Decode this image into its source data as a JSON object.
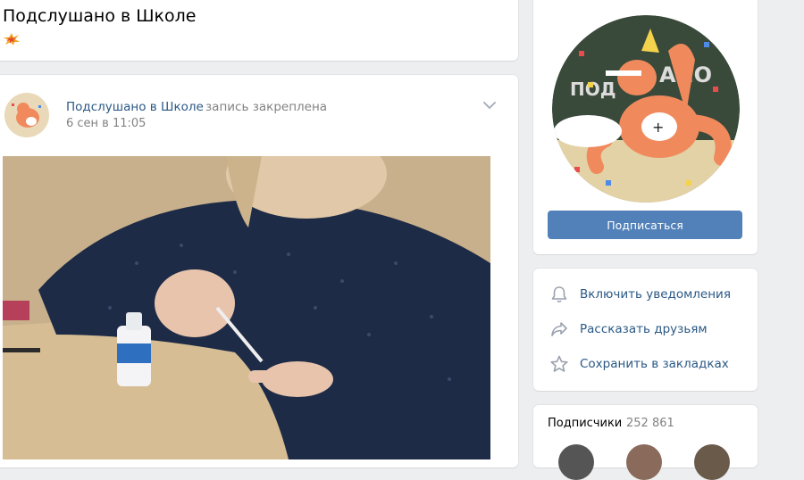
{
  "header": {
    "title": "Подслушано в Школе",
    "status_emoji": "burst-emoji-icon"
  },
  "post": {
    "author": "Подслушано в Школе",
    "pinned_label": "запись закреплена",
    "date": "6 сен в 11:05",
    "menu_icon": "chevron-down-icon"
  },
  "group": {
    "subscribe_label": "Подписаться"
  },
  "actions": [
    {
      "icon": "bell-icon",
      "label": "Включить уведомления"
    },
    {
      "icon": "share-arrow-icon",
      "label": "Рассказать друзьям"
    },
    {
      "icon": "star-icon",
      "label": "Сохранить в закладках"
    }
  ],
  "followers": {
    "label": "Подписчики",
    "count": "252 861"
  },
  "colors": {
    "link": "#2a5885",
    "button": "#5181b8",
    "muted": "#828282",
    "background": "#edeef0"
  }
}
